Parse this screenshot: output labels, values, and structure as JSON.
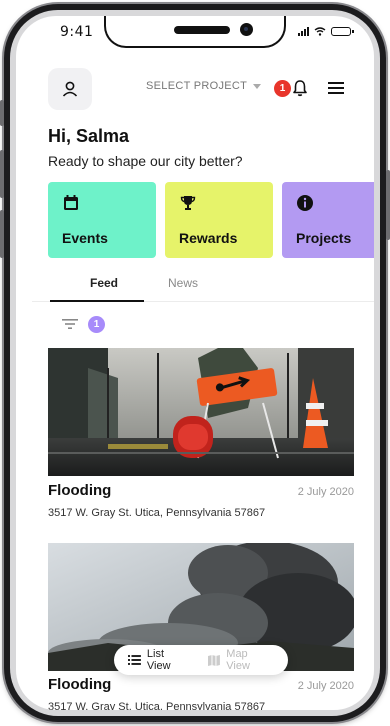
{
  "status_bar": {
    "time": "9:41"
  },
  "header": {
    "project_select": "SELECT PROJECT",
    "notification_count": "1"
  },
  "greeting": {
    "title": "Hi, Salma",
    "subtitle": "Ready to shape our city better?"
  },
  "categories": [
    {
      "label": "Events",
      "icon": "calendar-icon",
      "color": "#6ef2c9"
    },
    {
      "label": "Rewards",
      "icon": "trophy-icon",
      "color": "#e6f36a"
    },
    {
      "label": "Projects",
      "icon": "info-icon",
      "color": "#b39af2"
    }
  ],
  "tabs": [
    {
      "label": "Feed",
      "active": true
    },
    {
      "label": "News",
      "active": false
    }
  ],
  "filter": {
    "count": "1"
  },
  "feed": [
    {
      "title": "Flooding",
      "date": "2 July 2020",
      "address": "3517 W. Gray St. Utica, Pennsylvania 57867",
      "image": "flooded-street-with-detour-sign"
    },
    {
      "title": "Flooding",
      "date": "2 July 2020",
      "address": "3517 W. Gray St. Utica, Pennsylvania 57867",
      "image": "volcanic-ash-cloud"
    }
  ],
  "view_toggle": {
    "list_label": "List View",
    "map_label": "Map View"
  }
}
